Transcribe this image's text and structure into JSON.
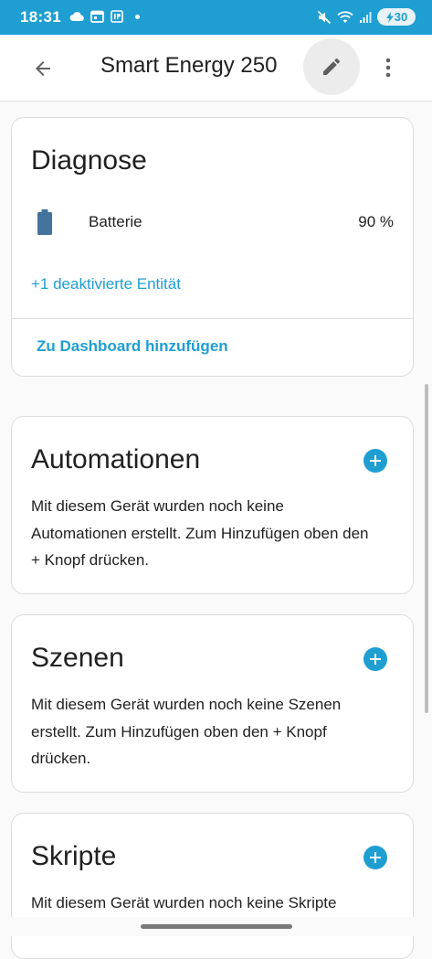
{
  "status_bar": {
    "time": "18:31",
    "battery": "30",
    "color": "#1f9ed2"
  },
  "app_bar": {
    "title": "Smart Energy 250"
  },
  "diagnose": {
    "title": "Diagnose",
    "entity_label": "Batterie",
    "entity_value": "90 %",
    "disabled_link": "+1 deaktivierte Entität",
    "dashboard_link": "Zu Dashboard hinzufügen"
  },
  "automations": {
    "title": "Automationen",
    "text": "Mit diesem Gerät wurden noch keine Automationen erstellt. Zum Hinzufügen oben den + Knopf drücken."
  },
  "scenes": {
    "title": "Szenen",
    "text": "Mit diesem Gerät wurden noch keine Szenen erstellt. Zum Hinzufügen oben den + Knopf drücken."
  },
  "scripts": {
    "title": "Skripte",
    "text": "Mit diesem Gerät wurden noch keine Skripte"
  },
  "icons": {
    "back": "arrow-left-icon",
    "edit": "pencil-icon",
    "more": "dots-vertical-icon",
    "battery": "battery-icon",
    "add": "plus-circle-icon"
  }
}
